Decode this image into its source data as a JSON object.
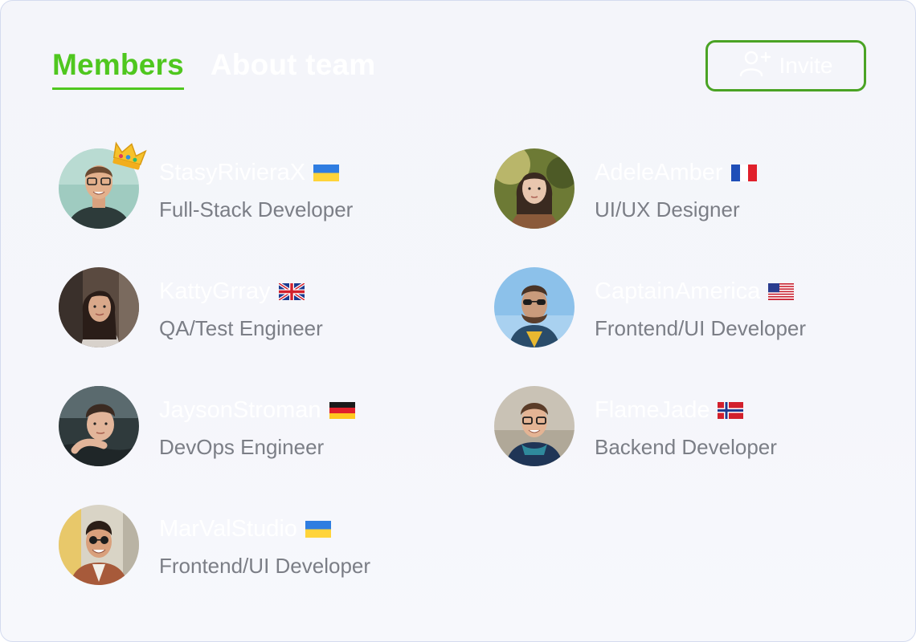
{
  "tabs": {
    "members": "Members",
    "about": "About team"
  },
  "invite_button": {
    "label": "Invite",
    "icon": "add-user-icon"
  },
  "colors": {
    "accent": "#4fc71f",
    "invite_border": "#4aa324",
    "role_text": "#7b7e86"
  },
  "members": [
    {
      "name": "StasyRivieraX",
      "role": "Full-Stack Developer",
      "flag": "ukraine-flag-icon",
      "crown": true
    },
    {
      "name": "AdeleAmber",
      "role": "UI/UX Designer",
      "flag": "france-flag-icon"
    },
    {
      "name": "KattyGrray",
      "role": "QA/Test Engineer",
      "flag": "uk-flag-icon"
    },
    {
      "name": "CaptainAmerica",
      "role": "Frontend/UI Developer",
      "flag": "usa-flag-icon"
    },
    {
      "name": "JaysonStroman",
      "role": "DevOps Engineer",
      "flag": "germany-flag-icon"
    },
    {
      "name": "FlameJade",
      "role": "Backend Developer",
      "flag": "norway-flag-icon"
    },
    {
      "name": "MarValStudio",
      "role": "Frontend/UI Developer",
      "flag": "ukraine-flag-icon"
    }
  ]
}
